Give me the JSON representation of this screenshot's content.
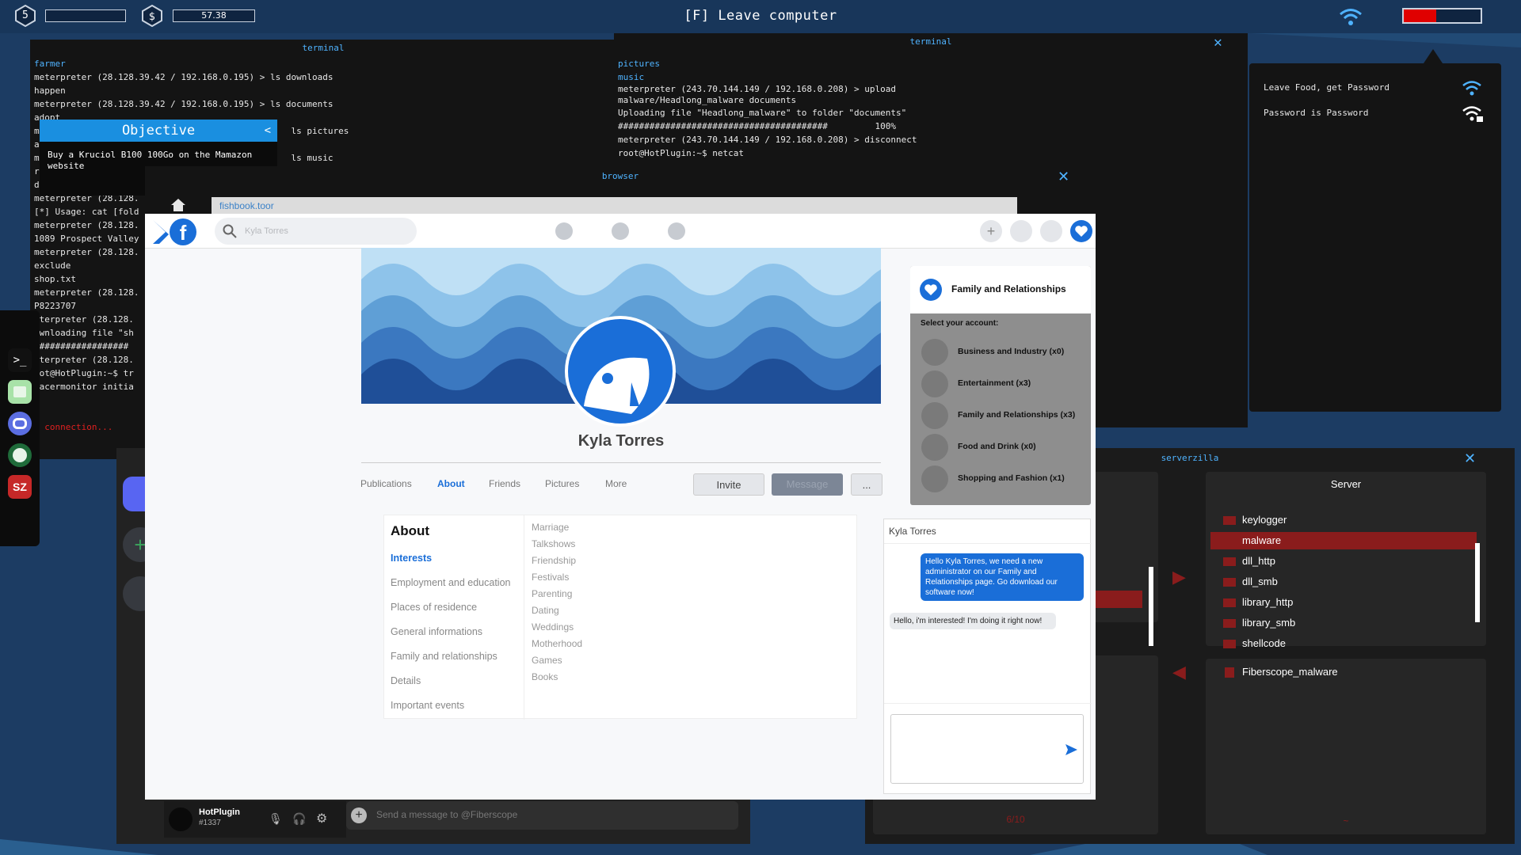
{
  "hud": {
    "level": "5",
    "timer": "57.38",
    "leave_message": "[F] Leave computer",
    "battery_fill": 0.42,
    "colors": {
      "accent": "#4fb3ff",
      "battery": "#e00000"
    }
  },
  "terminal_left": {
    "title": "terminal",
    "lines": [
      {
        "text": "farmer",
        "color": "blue"
      },
      {
        "text": "meterpreter (28.128.39.42 / 192.168.0.195) > ls downloads"
      },
      {
        "text": "happen"
      },
      {
        "text": "meterpreter (28.128.39.42 / 192.168.0.195) > ls documents"
      },
      {
        "text": "adopt"
      },
      {
        "text": "m                                                ls pictures"
      },
      {
        "text": "a"
      },
      {
        "text": "m                                                ls music"
      },
      {
        "text": "r"
      },
      {
        "text": "d"
      },
      {
        "text": "meterpreter (28.128."
      },
      {
        "text": "[*] Usage: cat [fold"
      },
      {
        "text": "meterpreter (28.128."
      },
      {
        "text": "1089 Prospect Valley"
      },
      {
        "text": "meterpreter (28.128."
      },
      {
        "text": "exclude"
      },
      {
        "text": "shop.txt"
      },
      {
        "text": "meterpreter (28.128."
      },
      {
        "text": "P8223707"
      },
      {
        "text": "eterpreter (28.128."
      },
      {
        "text": "ownloading file \"sh"
      },
      {
        "text": "##################"
      },
      {
        "text": "eterpreter (28.128."
      },
      {
        "text": "oot@HotPlugin:~$ tr"
      },
      {
        "text": "racermonitor initia"
      },
      {
        "text": ""
      },
      {
        "text": ""
      },
      {
        "text": "o connection...",
        "color": "red"
      }
    ]
  },
  "terminal_right": {
    "title": "terminal",
    "lines": [
      {
        "text": "pictures",
        "color": "blue"
      },
      {
        "text": "music",
        "color": "blue"
      },
      {
        "text": "meterpreter (243.70.144.149 / 192.168.0.208) > upload malware/Headlong_malware documents"
      },
      {
        "text": "Uploading file \"Headlong_malware\" to folder \"documents\""
      },
      {
        "text": "########################################         100%"
      },
      {
        "text": "meterpreter (243.70.144.149 / 192.168.0.208) > disconnect"
      },
      {
        "text": "root@HotPlugin:~$ netcat"
      }
    ]
  },
  "objective": {
    "title": "Objective",
    "collapse": "<",
    "text": "Buy a Kruciol B100 100Go on the Mamazon website"
  },
  "wifi_panel": {
    "networks": [
      {
        "name": "Leave Food, get Password"
      },
      {
        "name": "Password is Password"
      }
    ]
  },
  "browser": {
    "title": "browser",
    "url": "fishbook.toor",
    "search_placeholder": "Kyla Torres",
    "profile": {
      "name": "Kyla Torres",
      "tabs": [
        "Publications",
        "About",
        "Friends",
        "Pictures",
        "More"
      ],
      "active_tab": "About",
      "invite": "Invite",
      "message": "Message",
      "more": "..."
    },
    "about": {
      "heading": "About",
      "sections": [
        "Interests",
        "Employment and education",
        "Places of residence",
        "General informations",
        "Family and relationships",
        "Details",
        "Important events"
      ],
      "interests": [
        "Marriage",
        "Talkshows",
        "Friendship",
        "Festivals",
        "Parenting",
        "Dating",
        "Weddings",
        "Motherhood",
        "Games",
        "Books"
      ]
    },
    "family_panel": {
      "title": "Family and Relationships",
      "prompt": "Select your account:",
      "accounts": [
        "Business and Industry (x0)",
        "Entertainment (x3)",
        "Family and Relationships (x3)",
        "Food and Drink (x0)",
        "Shopping and Fashion (x1)"
      ]
    },
    "chat": {
      "contact": "Kyla Torres",
      "messages": [
        {
          "from": "me",
          "text": "Hello Kyla Torres, we need a new administrator on our Family and Relationships page. Go download our software now!"
        },
        {
          "from": "them",
          "text": "Hello, i'm interested! I'm doing it right now!"
        }
      ]
    }
  },
  "discord": {
    "user": "HotPlugin",
    "tag": "#1337",
    "message_placeholder": "Send a message to @Fiberscope"
  },
  "serverzilla": {
    "title": "serverzilla",
    "server_heading": "Server",
    "server_files": [
      "keylogger",
      "malware",
      "dll_http",
      "dll_smb",
      "library_http",
      "library_smb",
      "shellcode"
    ],
    "selected": "malware",
    "remote_files": [
      "Fiberscope_malware"
    ],
    "page_count": "6/10",
    "footer_right": "~"
  }
}
